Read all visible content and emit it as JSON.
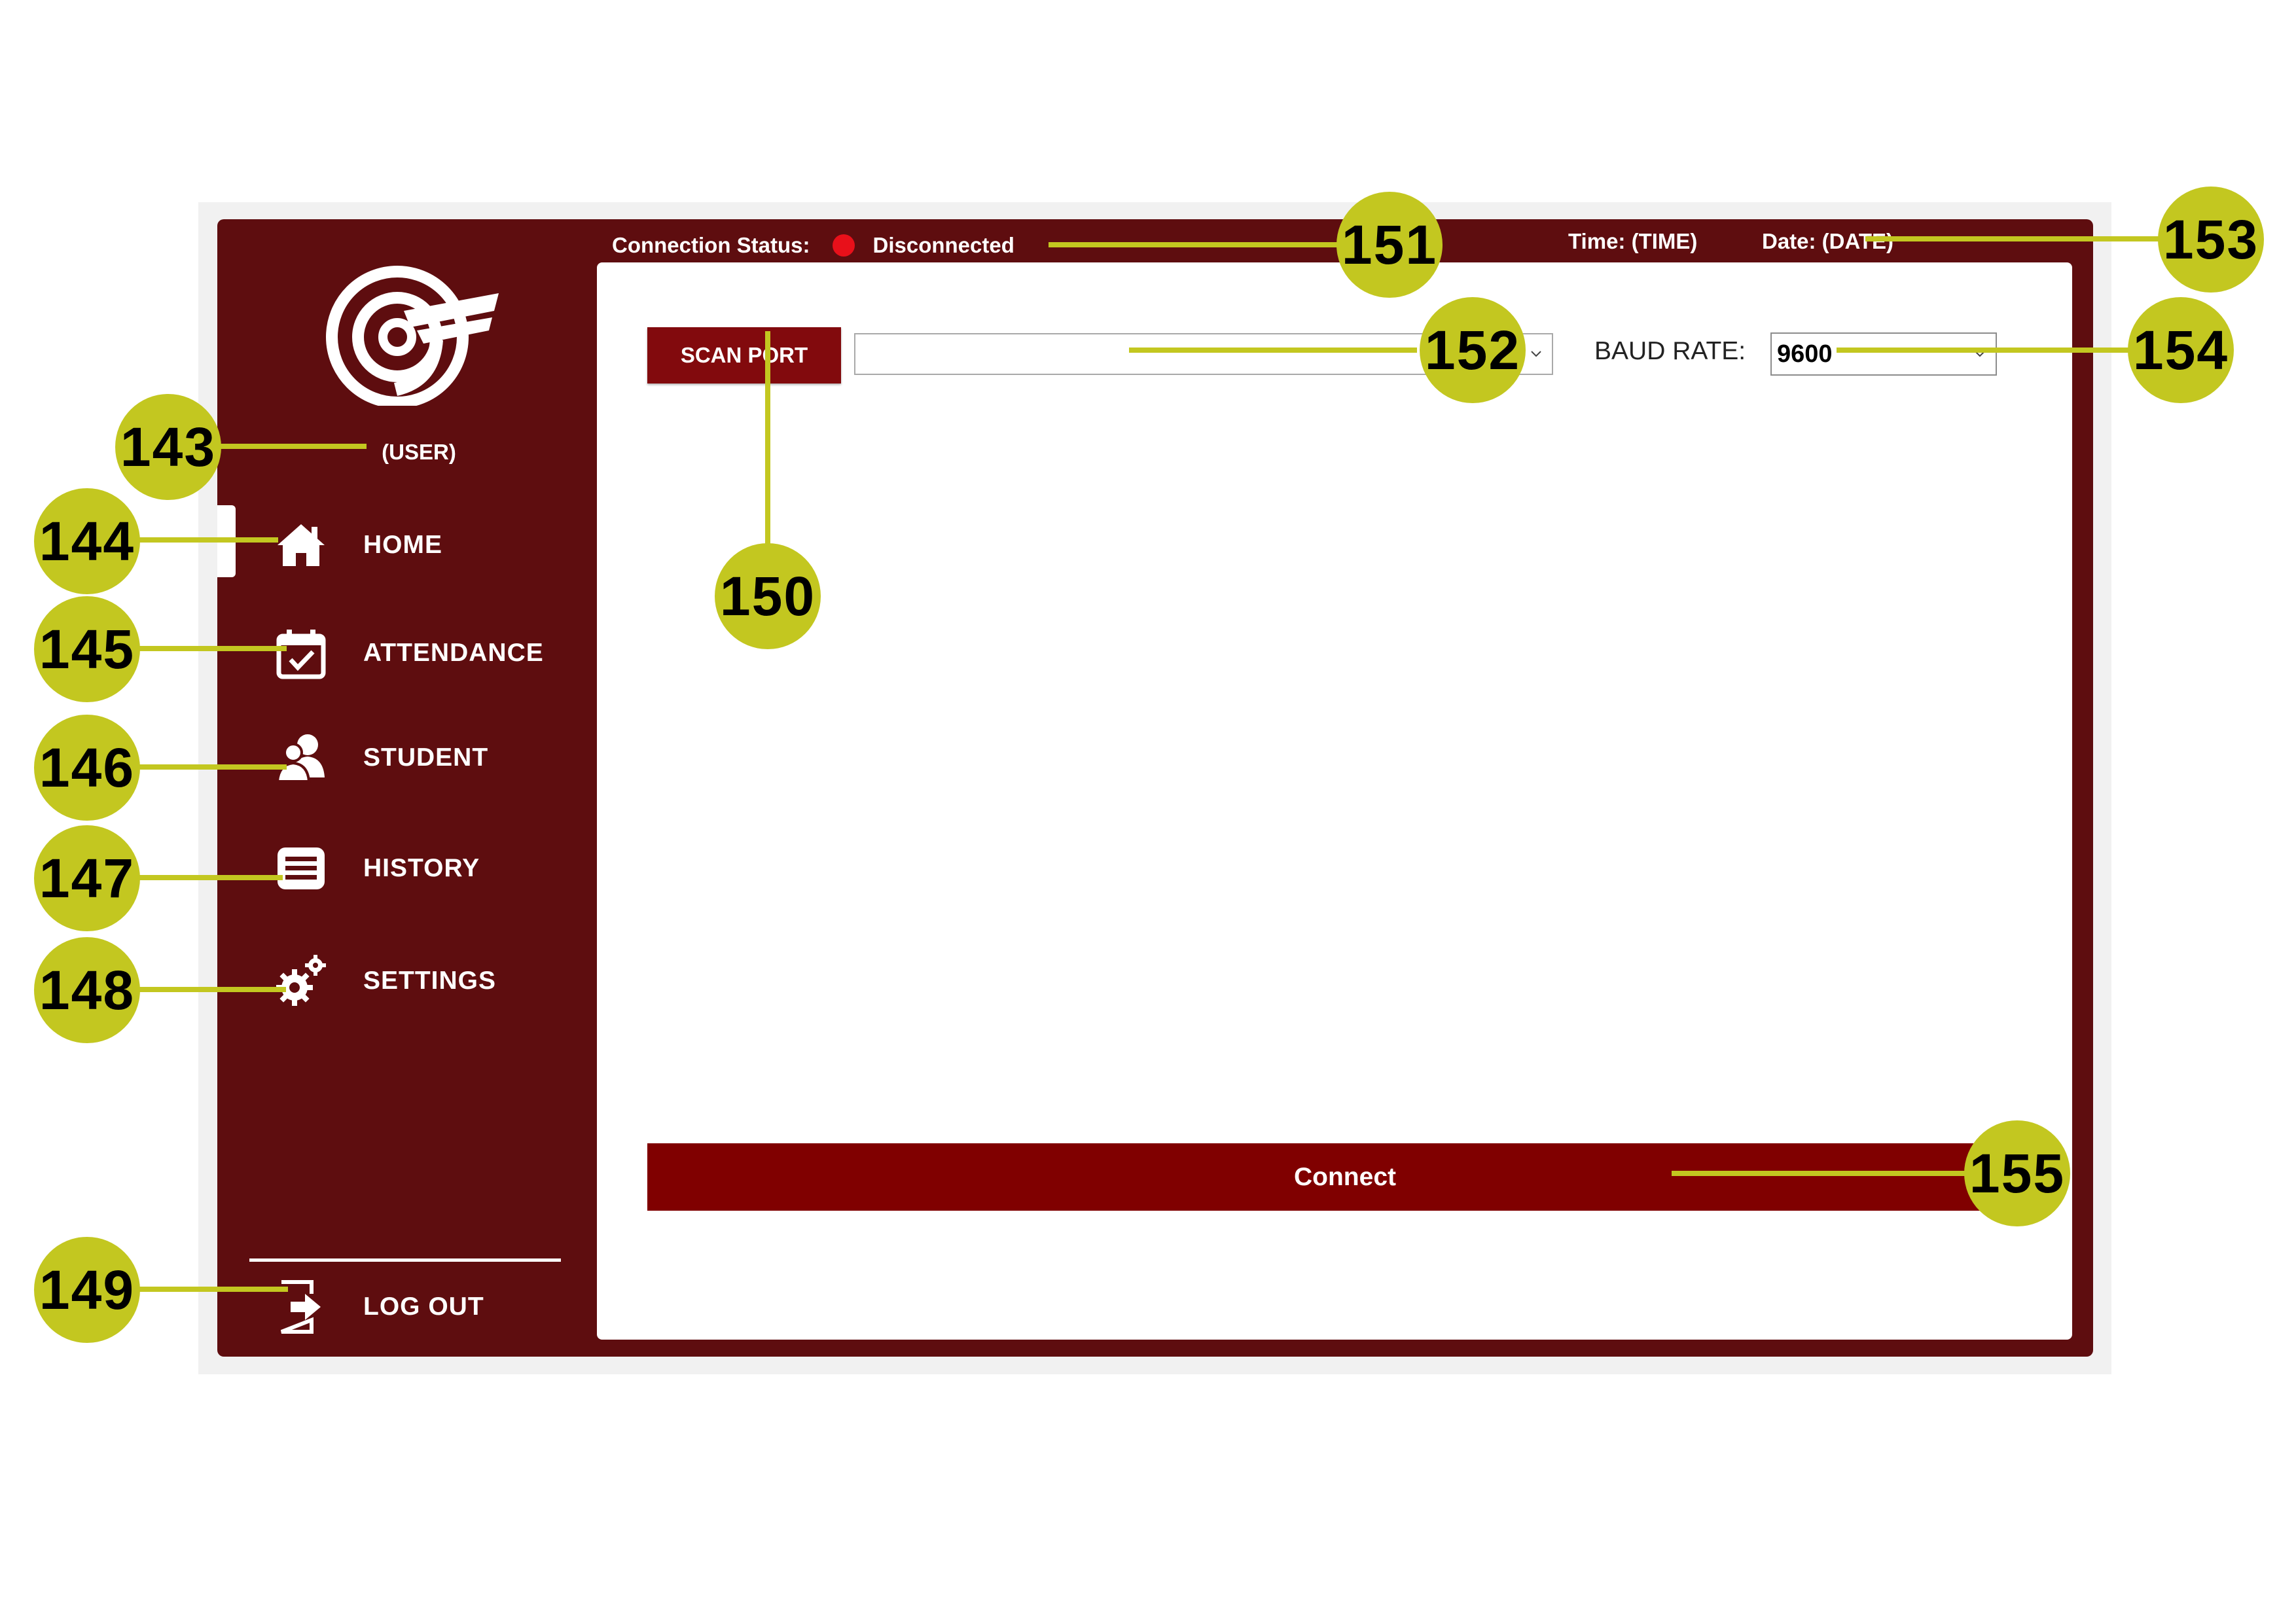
{
  "header": {
    "connection_status_label": "Connection Status:",
    "connection_status_value": "Disconnected",
    "time_text": "Time: (TIME)",
    "date_text": "Date:  (DATE)"
  },
  "sidebar": {
    "user_label": "(USER)",
    "items": [
      {
        "label": "HOME",
        "icon": "home-icon"
      },
      {
        "label": "ATTENDANCE",
        "icon": "calendar-check-icon"
      },
      {
        "label": "STUDENT",
        "icon": "users-icon"
      },
      {
        "label": "HISTORY",
        "icon": "list-icon"
      },
      {
        "label": "SETTINGS",
        "icon": "gears-icon"
      }
    ],
    "logout_label": "LOG OUT",
    "logout_icon": "logout-icon"
  },
  "main": {
    "scan_port_label": "SCAN PORT",
    "port_value": "",
    "baud_rate_label": "BAUD RATE:",
    "baud_rate_value": "9600",
    "connect_label": "Connect"
  },
  "callouts": [
    "143",
    "144",
    "145",
    "146",
    "147",
    "148",
    "149",
    "150",
    "151",
    "152",
    "153",
    "154",
    "155"
  ],
  "colors": {
    "sidebar_bg": "#5e0d0f",
    "button_bg": "#820a0d",
    "connect_bg": "#800000",
    "status_dot": "#e8101a",
    "callout": "#c3c720"
  }
}
